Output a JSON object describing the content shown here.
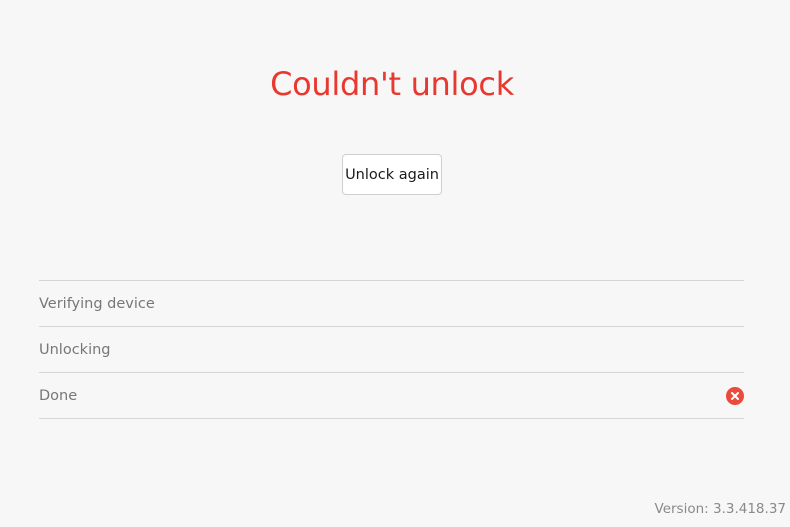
{
  "header": {
    "title": "Couldn't unlock"
  },
  "actions": {
    "retry_label": "Unlock again"
  },
  "steps": [
    {
      "label": "Verifying device",
      "status": "none"
    },
    {
      "label": "Unlocking",
      "status": "none"
    },
    {
      "label": "Done",
      "status": "error",
      "icon": "error-x-circle-icon"
    }
  ],
  "footer": {
    "version_text": "Version: 3.3.418.37"
  },
  "colors": {
    "title": "#e8382f",
    "error_icon": "#ea4b3c",
    "background": "#f7f7f7"
  }
}
